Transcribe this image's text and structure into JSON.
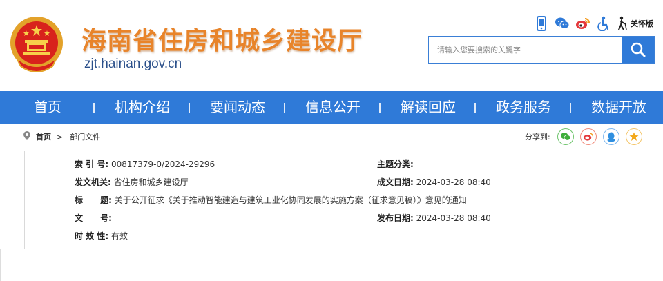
{
  "site": {
    "title": "海南省住房和城乡建设厅",
    "url": "zjt.hainan.gov.cn"
  },
  "top_icons": [
    "mobile-icon",
    "wechat-icon",
    "weibo-icon",
    "accessibility-icon",
    "elderly-care-icon"
  ],
  "care_label": "关怀版",
  "search": {
    "placeholder": "请输入您要搜索的关键字"
  },
  "nav": {
    "items": [
      "首页",
      "机构介绍",
      "要闻动态",
      "信息公开",
      "解读回应",
      "政务服务",
      "数据开放"
    ]
  },
  "breadcrumb": {
    "home": "首页",
    "arrow": ">",
    "current": "部门文件"
  },
  "share": {
    "label": "分享到:",
    "targets": [
      "wechat",
      "weibo",
      "qq",
      "qzone"
    ]
  },
  "meta": {
    "index_label": "索 引 号:",
    "index_value": "00817379-0/2024-29296",
    "topic_label": "主题分类:",
    "topic_value": "",
    "issuer_label": "发文机关:",
    "issuer_value": "省住房和城乡建设厅",
    "created_label": "成文日期:",
    "created_value": "2024-03-28 08:40",
    "title_label": "标      题:",
    "title_value": "关于公开征求《关于推动智能建造与建筑工业化协同发展的实施方案（征求意见稿）》意见的通知",
    "docno_label": "文      号:",
    "docno_value": "",
    "published_label": "发布日期:",
    "published_value": "2024-03-28 08:40",
    "validity_label": "时 效 性:",
    "validity_value": "有效"
  },
  "colors": {
    "nav_blue": "#2f7ad8",
    "title_orange": "#e8842a",
    "url_blue": "#2a4f8a"
  }
}
